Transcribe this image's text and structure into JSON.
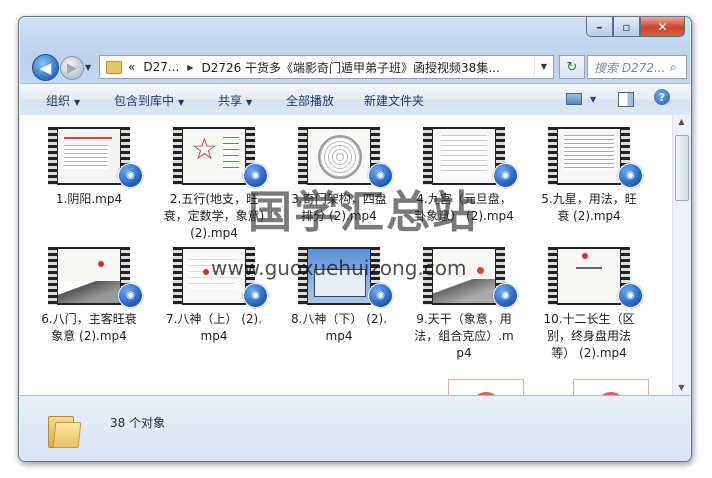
{
  "window": {
    "caption_buttons": [
      "minimize",
      "maximize",
      "close"
    ]
  },
  "navigation": {
    "back_icon": "back-arrow-icon",
    "forward_icon": "forward-arrow-icon",
    "address": {
      "overflow": "«",
      "crumbs": [
        "D27...",
        "D2726 干货多《端影奇门遁甲弟子班》函授视频38集..."
      ]
    },
    "search_placeholder": "搜索 D272..."
  },
  "toolbar": {
    "organize": "组织",
    "include_in_library": "包含到库中",
    "share": "共享",
    "play_all": "全部播放",
    "new_folder": "新建文件夹"
  },
  "files": [
    {
      "name": "1.阴阳.mp4"
    },
    {
      "name": "2.五行(地支，旺衰，定数学，象意) (2).mp4"
    },
    {
      "name": "3.奇门架构，四盘排分 (2).mp4"
    },
    {
      "name": "4.九宫（元旦盘，卦象意） (2).mp4"
    },
    {
      "name": "5.九星，用法，旺衰 (2).mp4"
    },
    {
      "name": "6.八门，主客旺衰象意 (2).mp4"
    },
    {
      "name": "7.八神（上） (2).mp4"
    },
    {
      "name": "8.八神（下） (2).mp4"
    },
    {
      "name": "9.天干（象意，用法，组合克应）.mp4"
    },
    {
      "name": "10.十二长生（区别，终身盘用法等） (2).mp4"
    }
  ],
  "status": {
    "count": "38 个对象"
  },
  "watermark": {
    "line1": "国学汇总站",
    "line2": "www.guoxuehuizong.com"
  },
  "colors": {
    "accent": "#1f5bb8",
    "toolbar_text": "#1e395b"
  }
}
